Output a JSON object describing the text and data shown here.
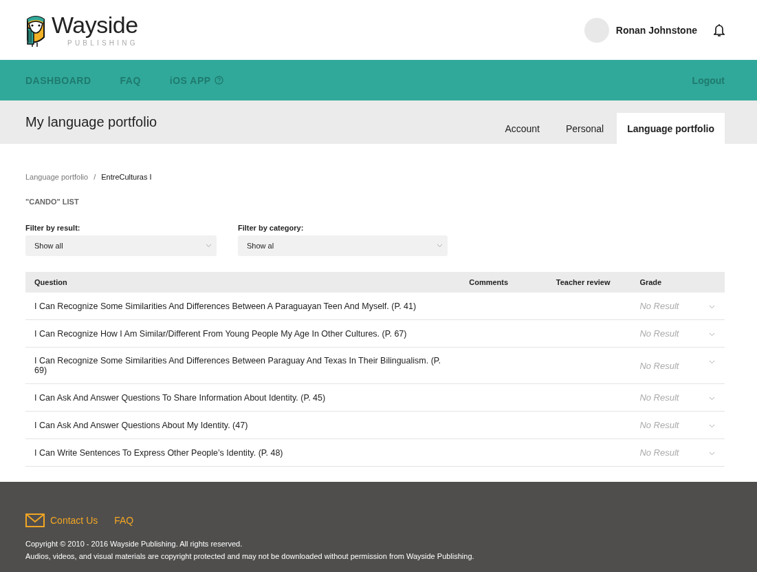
{
  "header": {
    "logo": {
      "name": "Wayside",
      "tagline": "PUBLISHING"
    },
    "user": {
      "name": "Ronan Johnstone"
    }
  },
  "nav": {
    "items": [
      {
        "label": "DASHBOARD",
        "help": false
      },
      {
        "label": "FAQ",
        "help": false
      },
      {
        "label": "iOS APP",
        "help": true
      }
    ],
    "logout": "Logout"
  },
  "page": {
    "title": "My language portfolio",
    "tabs": [
      {
        "label": "Account",
        "selected": false
      },
      {
        "label": "Personal",
        "selected": false
      },
      {
        "label": "Language portfolio",
        "selected": true
      }
    ]
  },
  "breadcrumb": [
    {
      "label": "Language portfolio",
      "current": false
    },
    {
      "label": "EntreCulturas I",
      "current": true
    }
  ],
  "breadcrumb_separator": "/",
  "section_title": "\"CANDO\" LIST",
  "filters": [
    {
      "label": "Filter by result:",
      "value": "Show all"
    },
    {
      "label": "Filter by category:",
      "value": "Show al"
    }
  ],
  "table": {
    "columns": [
      "Question",
      "Comments",
      "Teacher review",
      "Grade"
    ],
    "rows": [
      {
        "question": "I Can Recognize Some Similarities And Differences Between A Paraguayan Teen And Myself. (P. 41)",
        "grade": "No Result"
      },
      {
        "question": "I Can Recognize How I Am Similar/Different From Young People My Age In Other Cultures. (P. 67)",
        "grade": "No Result"
      },
      {
        "question": "I Can Recognize Some Similarities And Differences Between Paraguay And Texas In Their Bilingualism. (P. 69)",
        "grade": "No Result"
      },
      {
        "question": "I Can Ask And Answer Questions To Share Information About Identity. (P. 45)",
        "grade": "No Result"
      },
      {
        "question": "I Can Ask And Answer Questions About My Identity. (47)",
        "grade": "No Result"
      },
      {
        "question": "I Can Write Sentences To Express Other People’s Identity. (P. 48)",
        "grade": "No Result"
      }
    ]
  },
  "footer": {
    "links": [
      {
        "label": "Contact Us",
        "kind": "mail"
      },
      {
        "label": "FAQ",
        "kind": "plain"
      }
    ],
    "copyright": "Copyright © 2010 - 2016 Wayside Publishing. All rights reserved.",
    "notice": "Audios, videos, and visual materials are copyright protected and may not be downloaded without permission from Wayside Publishing."
  }
}
